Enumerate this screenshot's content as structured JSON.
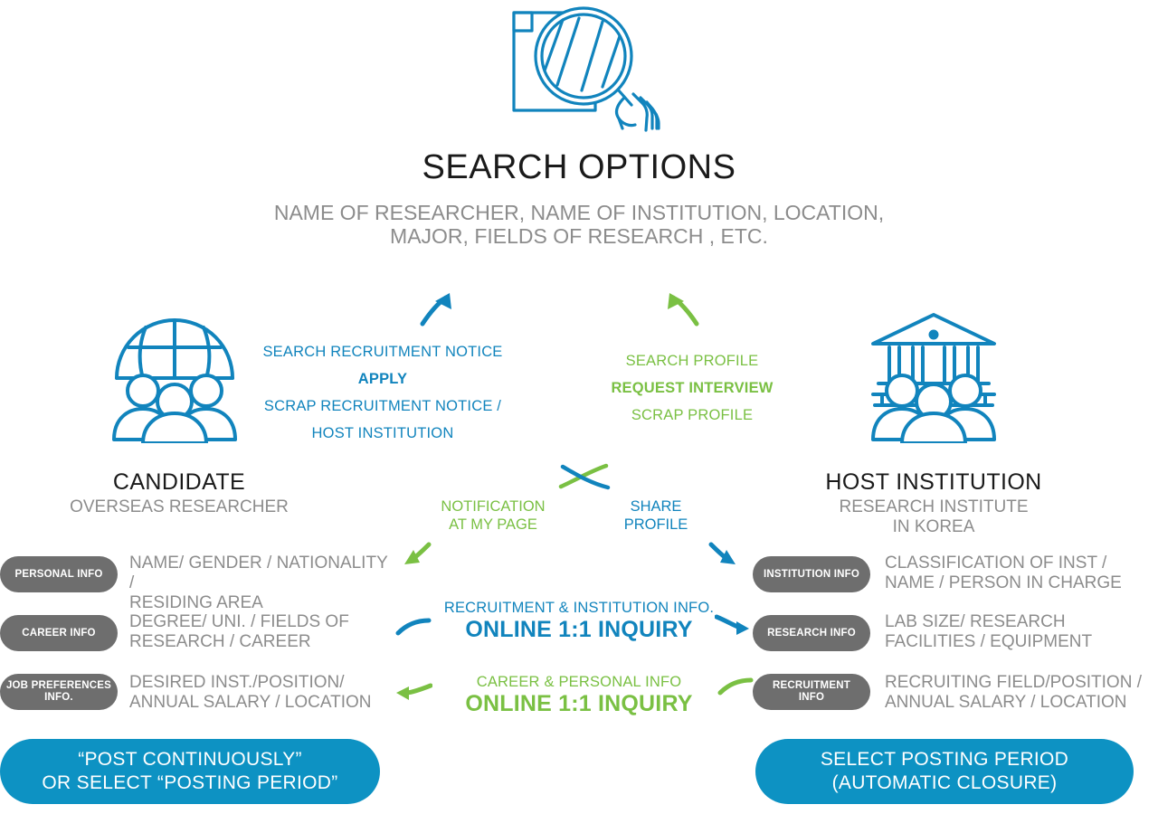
{
  "header": {
    "icon": "document-magnifier-icon",
    "title": "SEARCH OPTIONS",
    "subtitle_line1": "NAME OF RESEARCHER, NAME OF INSTITUTION, LOCATION,",
    "subtitle_line2": "MAJOR, FIELDS OF RESEARCH , ETC."
  },
  "colors": {
    "blue": "#1184bd",
    "blue_button": "#0d92c3",
    "green": "#7ac043",
    "pill_gray": "#6e6e6e",
    "text_gray": "#8c8c8c",
    "title_black": "#1a1a1a"
  },
  "candidate": {
    "icon": "globe-people-icon",
    "title": "CANDIDATE",
    "subtitle": "OVERSEAS RESEARCHER",
    "actions": [
      {
        "label": "SEARCH RECRUITMENT NOTICE",
        "bold": false
      },
      {
        "label": "APPLY",
        "bold": true
      },
      {
        "label": "SCRAP RECRUITMENT NOTICE /",
        "bold": false
      },
      {
        "label": "HOST INSTITUTION",
        "bold": false
      }
    ],
    "info_rows": [
      {
        "pill": "PERSONAL INFO",
        "text_line1": "NAME/ GENDER / NATIONALITY /",
        "text_line2": "RESIDING AREA"
      },
      {
        "pill": "CAREER INFO",
        "text_line1": "DEGREE/ UNI. / FIELDS OF",
        "text_line2": "RESEARCH / CAREER"
      },
      {
        "pill_line1": "JOB PREFERENCES",
        "pill_line2": "INFO.",
        "text_line1": "DESIRED INST./POSITION/",
        "text_line2": "ANNUAL SALARY / LOCATION"
      }
    ],
    "cta_line1": "“POST CONTINUOUSLY”",
    "cta_line2": "OR SELECT “POSTING PERIOD”"
  },
  "host": {
    "icon": "institution-people-icon",
    "title": "HOST  INSTITUTION",
    "subtitle_line1": "RESEARCH INSTITUTE",
    "subtitle_line2": "IN KOREA",
    "actions": [
      {
        "label": "SEARCH PROFILE",
        "bold": false
      },
      {
        "label": "REQUEST INTERVIEW",
        "bold": true
      },
      {
        "label": "SCRAP PROFILE",
        "bold": false
      }
    ],
    "info_rows": [
      {
        "pill": "INSTITUTION INFO",
        "text_line1": "CLASSIFICATION OF INST /",
        "text_line2": "NAME / PERSON IN CHARGE"
      },
      {
        "pill": "RESEARCH INFO",
        "text_line1": "LAB SIZE/  RESEARCH",
        "text_line2": "FACILITIES / EQUIPMENT"
      },
      {
        "pill_line1": "RECRUITMENT",
        "pill_line2": "INFO",
        "text_line1": "RECRUITING FIELD/POSITION /",
        "text_line2": "ANNUAL SALARY / LOCATION"
      }
    ],
    "cta_line1": "SELECT POSTING PERIOD",
    "cta_line2": "(AUTOMATIC CLOSURE)"
  },
  "center_flows": {
    "notification_line1": "NOTIFICATION",
    "notification_line2": "AT  MY PAGE",
    "share_line1": "SHARE",
    "share_line2": "PROFILE",
    "recruitment_small": "RECRUITMENT & INSTITUTION INFO.",
    "recruitment_big": "ONLINE 1:1 INQUIRY",
    "career_small": "CAREER & PERSONAL INFO",
    "career_big": "ONLINE 1:1 INQUIRY"
  }
}
